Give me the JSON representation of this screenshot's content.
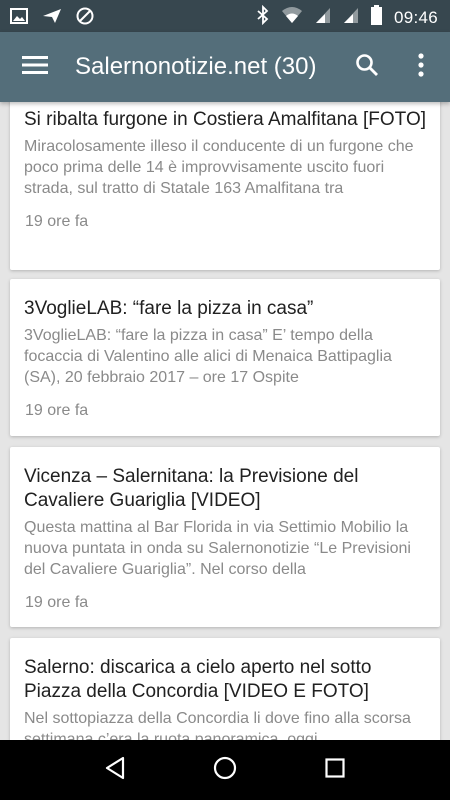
{
  "status_bar": {
    "time": "09:46",
    "icons": [
      "image-icon",
      "send-icon",
      "blocked-icon",
      "bluetooth-icon",
      "wifi-icon",
      "signal-icon",
      "signal-icon",
      "battery-icon"
    ]
  },
  "app_bar": {
    "title": "Salernonotizie.net (30)",
    "icons": [
      "menu-icon",
      "search-icon",
      "more-vert-icon"
    ],
    "background": "#546e7a"
  },
  "articles": [
    {
      "title": "Si ribalta furgone in Costiera Amalfitana [FOTO]",
      "summary": "Miracolosamente illeso il conducente di un furgone che poco prima delle 14 è improvvisamente uscito fuori strada, sul tratto di Statale 163 Amalfitana tra",
      "time": "19 ore fa"
    },
    {
      "title": "3VoglieLAB: “fare la pizza in casa”",
      "summary": "3VoglieLAB: “fare la pizza in casa” E’ tempo della focaccia di Valentino alle alici di Menaica Battipaglia (SA), 20 febbraio 2017 – ore 17 Ospite",
      "time": "19 ore fa"
    },
    {
      "title": "Vicenza – Salernitana: la Previsione del Cavaliere Guariglia [VIDEO]",
      "summary": "Questa mattina al Bar Florida in via Settimio Mobilio la nuova puntata in onda su Salernonotizie “Le Previsioni del Cavaliere Guariglia”. Nel corso della",
      "time": "19 ore fa"
    },
    {
      "title": "Salerno: discarica a cielo aperto nel sotto Piazza della Concordia [VIDEO E FOTO]",
      "summary": "Nel sottopiazza della Concordia li dove fino alla scorsa settimana c’era la ruota panoramica, oggi",
      "time": ""
    }
  ],
  "nav_bar": {
    "icons": [
      "back-icon",
      "home-icon",
      "recents-icon"
    ]
  }
}
